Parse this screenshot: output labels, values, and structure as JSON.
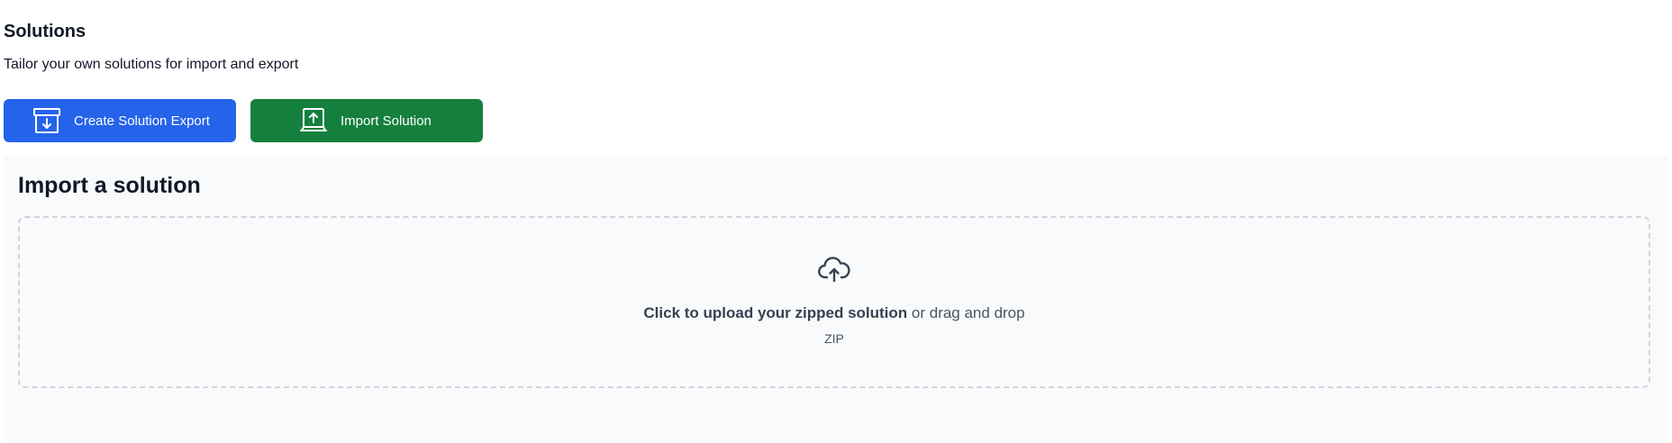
{
  "header": {
    "title": "Solutions",
    "subtitle": "Tailor your own solutions for import and export"
  },
  "actions": {
    "export_label": "Create Solution Export",
    "export_icon": "archive-download-icon",
    "export_color": "#2563eb",
    "import_label": "Import Solution",
    "import_icon": "laptop-upload-icon",
    "import_color": "#15803d"
  },
  "import_panel": {
    "title": "Import a solution",
    "dropzone": {
      "icon": "cloud-upload-icon",
      "cta_strong": "Click to upload your zipped solution",
      "cta_rest": " or drag and drop",
      "hint": "ZIP"
    }
  }
}
